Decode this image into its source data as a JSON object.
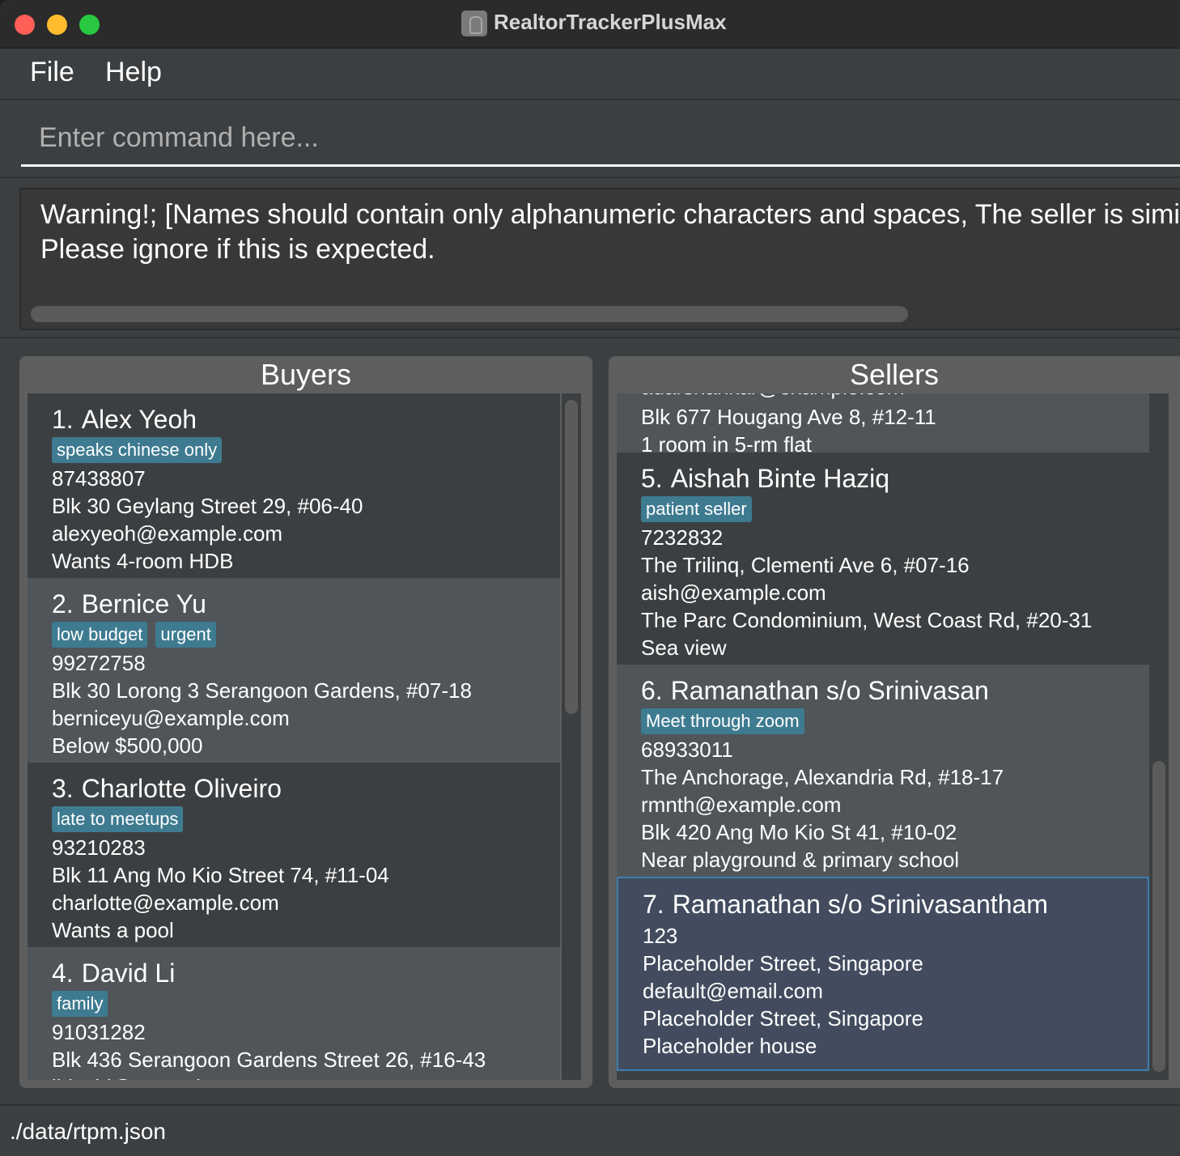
{
  "window": {
    "title": "RealtorTrackerPlusMax"
  },
  "menu": {
    "file": "File",
    "help": "Help"
  },
  "command": {
    "placeholder": "Enter command here..."
  },
  "result": {
    "line1": "Warning!; [Names should contain only alphanumeric characters and spaces, The seller is similar to",
    "line2": "Please ignore if this is expected."
  },
  "buyers": {
    "title": "Buyers",
    "items": [
      {
        "index": "1.",
        "name": "Alex Yeoh",
        "tags": [
          "speaks chinese only"
        ],
        "phone": "87438807",
        "address": "Blk 30 Geylang Street 29, #06-40",
        "email": "alexyeoh@example.com",
        "note": "Wants 4-room HDB"
      },
      {
        "index": "2.",
        "name": "Bernice Yu",
        "tags": [
          "low budget",
          "urgent"
        ],
        "phone": "99272758",
        "address": "Blk 30 Lorong 3 Serangoon Gardens, #07-18",
        "email": "berniceyu@example.com",
        "note": "Below $500,000"
      },
      {
        "index": "3.",
        "name": "Charlotte Oliveiro",
        "tags": [
          "late to meetups"
        ],
        "phone": "93210283",
        "address": "Blk 11 Ang Mo Kio Street 74, #11-04",
        "email": "charlotte@example.com",
        "note": "Wants a pool"
      },
      {
        "index": "4.",
        "name": "David Li",
        "tags": [
          "family"
        ],
        "phone": "91031282",
        "address": "Blk 436 Serangoon Gardens Street 26, #16-43",
        "email": "lidavid@example.com"
      }
    ]
  },
  "sellers": {
    "title": "Sellers",
    "partial": {
      "email": "adarshankar@example.com",
      "house": "Blk 677 Hougang Ave 8, #12-11",
      "note": "1 room in 5-rm flat"
    },
    "items": [
      {
        "index": "5.",
        "name": "Aishah Binte Haziq",
        "tags": [
          "patient seller"
        ],
        "phone": "7232832",
        "address": "The Trilinq, Clementi Ave 6, #07-16",
        "email": "aish@example.com",
        "house": "The Parc Condominium, West Coast Rd, #20-31",
        "note": "Sea view"
      },
      {
        "index": "6.",
        "name": "Ramanathan s/o Srinivasan",
        "tags": [
          "Meet through zoom"
        ],
        "phone": "68933011",
        "address": "The Anchorage, Alexandria Rd, #18-17",
        "email": "rmnth@example.com",
        "house": "Blk 420 Ang Mo Kio St 41, #10-02",
        "note": "Near playground & primary school"
      },
      {
        "index": "7.",
        "name": "Ramanathan s/o Srinivasantham",
        "phone": "123",
        "address": "Placeholder Street, Singapore",
        "email": "default@email.com",
        "house": "Placeholder Street, Singapore",
        "note": "Placeholder house"
      }
    ]
  },
  "status": {
    "path": "./data/rtpm.json"
  },
  "colors": {
    "tag": "#3e7b91",
    "selected_border": "#3c7db0",
    "background": "#3c3f41"
  }
}
